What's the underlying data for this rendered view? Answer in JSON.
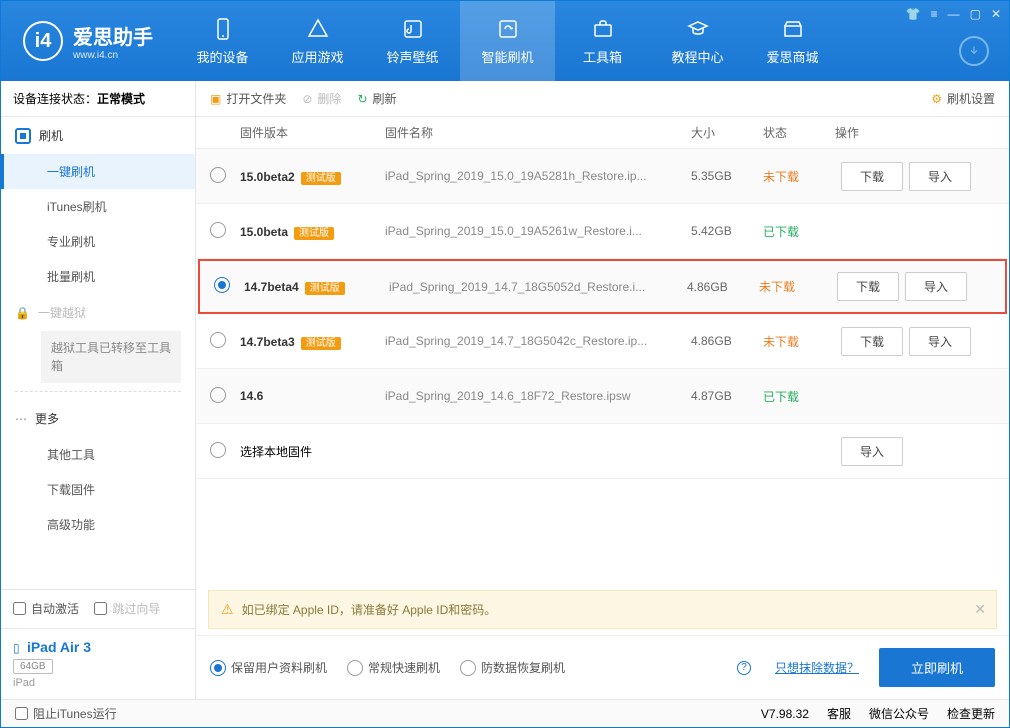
{
  "brand": {
    "name": "爱思助手",
    "site": "www.i4.cn"
  },
  "nav": [
    {
      "label": "我的设备"
    },
    {
      "label": "应用游戏"
    },
    {
      "label": "铃声壁纸"
    },
    {
      "label": "智能刷机"
    },
    {
      "label": "工具箱"
    },
    {
      "label": "教程中心"
    },
    {
      "label": "爱思商城"
    }
  ],
  "sidebar": {
    "status_label": "设备连接状态：",
    "status_value": "正常模式",
    "head_flash": "刷机",
    "items": [
      "一键刷机",
      "iTunes刷机",
      "专业刷机",
      "批量刷机"
    ],
    "jailbreak": "一键越狱",
    "note": "越狱工具已转移至工具箱",
    "head_more": "更多",
    "more": [
      "其他工具",
      "下载固件",
      "高级功能"
    ],
    "auto_activate": "自动激活",
    "skip_guide": "跳过向导",
    "device_name": "iPad Air 3",
    "device_cap": "64GB",
    "device_type": "iPad"
  },
  "toolbar": {
    "open": "打开文件夹",
    "delete": "删除",
    "refresh": "刷新",
    "settings": "刷机设置"
  },
  "columns": {
    "version": "固件版本",
    "name": "固件名称",
    "size": "大小",
    "status": "状态",
    "action": "操作"
  },
  "rows": [
    {
      "ver": "15.0beta2",
      "tag": "测试版",
      "name": "iPad_Spring_2019_15.0_19A5281h_Restore.ip...",
      "size": "5.35GB",
      "status": "未下载",
      "download": "下载",
      "import": "导入",
      "sel": false,
      "done": false
    },
    {
      "ver": "15.0beta",
      "tag": "测试版",
      "name": "iPad_Spring_2019_15.0_19A5261w_Restore.i...",
      "size": "5.42GB",
      "status": "已下载",
      "sel": false,
      "done": true
    },
    {
      "ver": "14.7beta4",
      "tag": "测试版",
      "name": "iPad_Spring_2019_14.7_18G5052d_Restore.i...",
      "size": "4.86GB",
      "status": "未下载",
      "download": "下载",
      "import": "导入",
      "sel": true,
      "done": false,
      "hl": true
    },
    {
      "ver": "14.7beta3",
      "tag": "测试版",
      "name": "iPad_Spring_2019_14.7_18G5042c_Restore.ip...",
      "size": "4.86GB",
      "status": "未下载",
      "download": "下载",
      "import": "导入",
      "sel": false,
      "done": false
    },
    {
      "ver": "14.6",
      "tag": "",
      "name": "iPad_Spring_2019_14.6_18F72_Restore.ipsw",
      "size": "4.87GB",
      "status": "已下载",
      "sel": false,
      "done": true
    }
  ],
  "local_row": {
    "label": "选择本地固件",
    "import": "导入"
  },
  "notice": "如已绑定 Apple ID，请准备好 Apple ID和密码。",
  "options": {
    "o1": "保留用户资料刷机",
    "o2": "常规快速刷机",
    "o3": "防数据恢复刷机",
    "link": "只想抹除数据？",
    "go": "立即刷机"
  },
  "footer": {
    "block": "阻止iTunes运行",
    "ver": "V7.98.32",
    "svc": "客服",
    "wx": "微信公众号",
    "upd": "检查更新"
  }
}
